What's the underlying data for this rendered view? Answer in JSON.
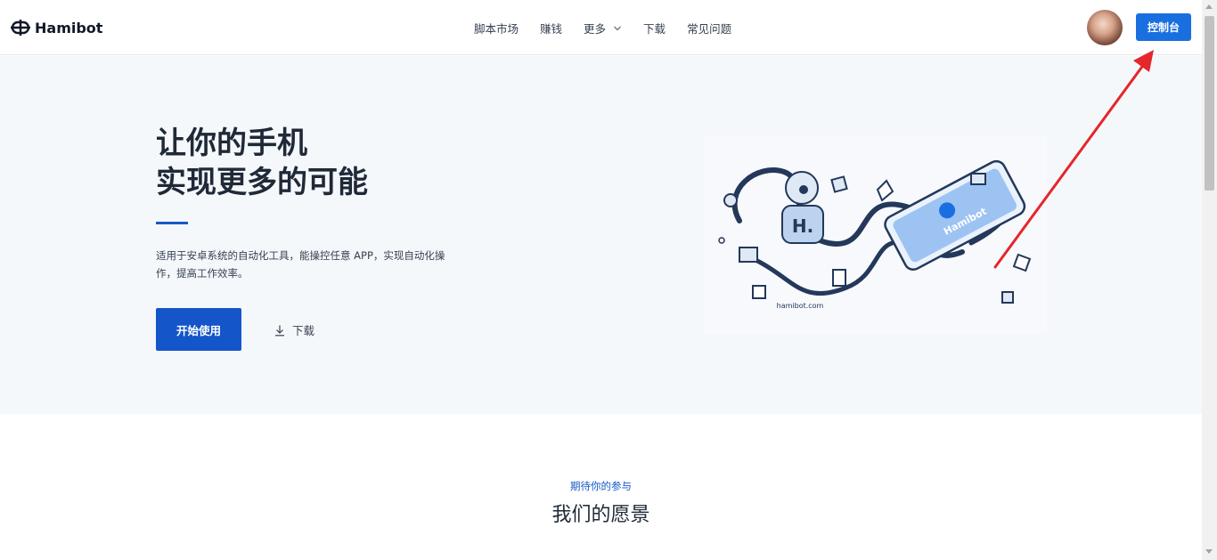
{
  "brand": {
    "name": "Hamibot",
    "logo_icon": "hamibot-logo-icon"
  },
  "nav": {
    "items": [
      {
        "label": "脚本市场"
      },
      {
        "label": "赚钱"
      },
      {
        "label": "更多",
        "has_dropdown": true
      },
      {
        "label": "下载"
      },
      {
        "label": "常见问题"
      }
    ]
  },
  "header": {
    "console_label": "控制台",
    "avatar": "user-avatar"
  },
  "hero": {
    "title_line1": "让你的手机",
    "title_line2": "实现更多的可能",
    "description": "适用于安卓系统的自动化工具，能操控任意 APP，实现自动化操作，提高工作效率。",
    "start_label": "开始使用",
    "download_label": "下载",
    "illustration_caption": "hamibot.com",
    "phone_brand": "Hamibot"
  },
  "section": {
    "subtitle": "期待你的参与",
    "title": "我们的愿景"
  },
  "colors": {
    "primary": "#1456c9",
    "console_button": "#1a6fe0",
    "hero_bg": "#f5f8fb",
    "annotation_arrow": "#e5262b"
  }
}
